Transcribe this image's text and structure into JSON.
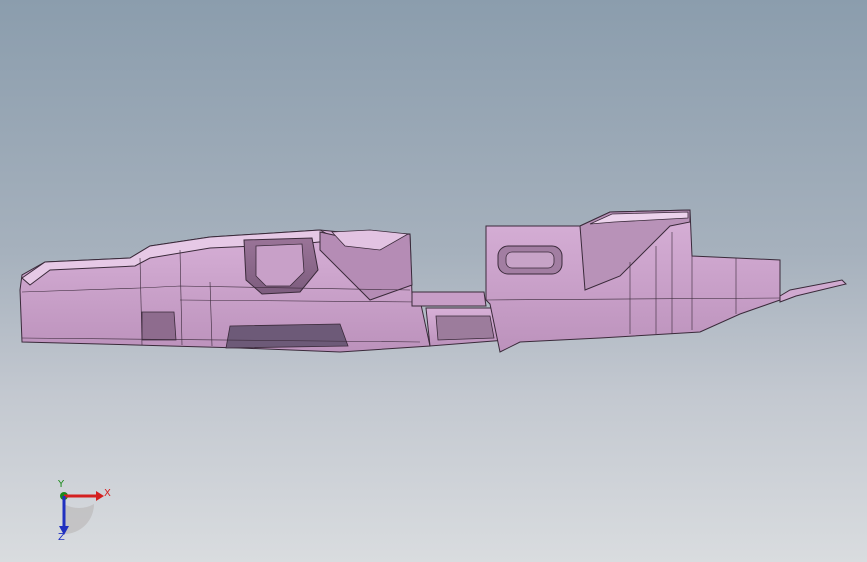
{
  "viewport": {
    "background_top": "#8b9dad",
    "background_bottom": "#d9dcdf",
    "model_color": "#c59bc5",
    "edge_color": "#3a2a3a"
  },
  "triad": {
    "x_label": "X",
    "y_label": "Y",
    "z_label": "Z",
    "x_color": "#d42020",
    "y_color": "#1a8a1a",
    "z_color": "#2030c0"
  }
}
